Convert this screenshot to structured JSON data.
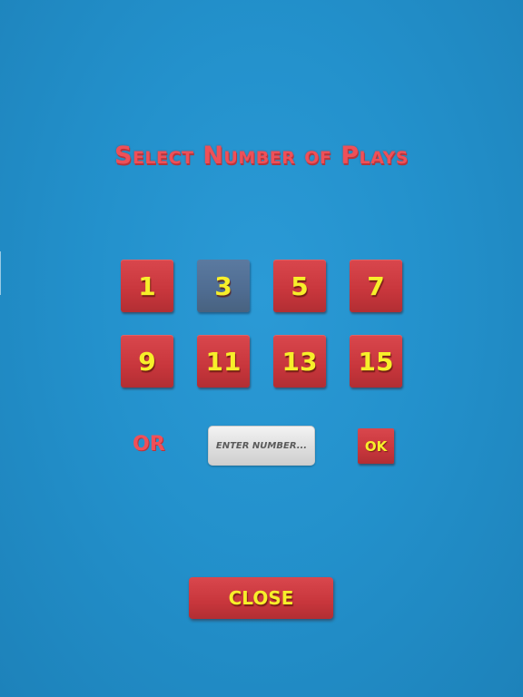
{
  "dialog": {
    "title": "Select Number of Plays"
  },
  "play_options": [
    {
      "label": "1",
      "selected": false
    },
    {
      "label": "3",
      "selected": true
    },
    {
      "label": "5",
      "selected": false
    },
    {
      "label": "7",
      "selected": false
    },
    {
      "label": "9",
      "selected": false
    },
    {
      "label": "11",
      "selected": false
    },
    {
      "label": "13",
      "selected": false
    },
    {
      "label": "15",
      "selected": false
    }
  ],
  "custom_entry": {
    "or_label": "OR",
    "input_value": "",
    "input_placeholder": "ENTER NUMBER...",
    "ok_label": "OK"
  },
  "footer": {
    "close_label": "CLOSE"
  },
  "colors": {
    "background": "#2391cc",
    "button_red": "#c8363c",
    "button_selected": "#4f6c91",
    "button_text_yellow": "#f7ef2a",
    "title_red": "#ef5058"
  }
}
